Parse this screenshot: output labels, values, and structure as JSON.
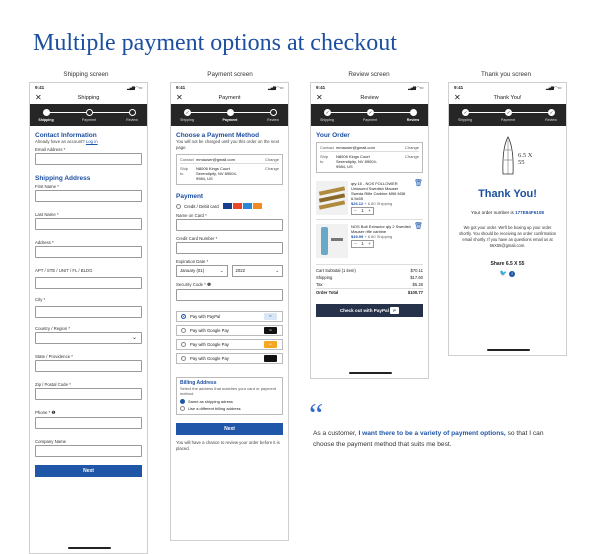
{
  "header": "Multiple payment options at checkout",
  "captions": [
    "Shipping screen",
    "Payment screen",
    "Review screen",
    "Thank you screen"
  ],
  "status_time": "9:41",
  "steps": [
    "Shipping",
    "Payment",
    "Review"
  ],
  "ship": {
    "title": "Shipping",
    "contact": "Contact Information",
    "account_q": "Already have an account?",
    "login": "Log in",
    "email": "Email Address *",
    "shipping_addr": "Shipping Address",
    "fields": [
      "First Name *",
      "Last Name *",
      "Address *",
      "APT / STE / UNIT / FL / BLDG",
      "City *",
      "Country / Region *",
      "State / Providence *",
      "Zip / Postal Code *",
      "Phone * ❶",
      "Company Name"
    ],
    "next": "Next"
  },
  "pay": {
    "title": "Payment",
    "choose": "Choose a Payment Method",
    "note": "You will not be charged until you this order on the next page.",
    "contact_k": "Contact",
    "contact_v": "mmauser@gmail.com",
    "change": "Change",
    "ship_k": "Ship to",
    "ship_v": "N8006 Kings Court Serendipity, NV 89004-9984, US",
    "payment": "Payment",
    "card": "Credit / Debit card",
    "name_card": "Name on Card *",
    "card_num": "Credit Card Number *",
    "exp": "Expiration Date *",
    "month": "January (01)",
    "year": "2022",
    "sec": "Security Code * ❶",
    "opts": [
      "Pay with PayPal",
      "Pay with Google Pay",
      "Pay with Google Pay",
      "Pay with Google Pay"
    ],
    "billing": "Billing Address",
    "billing_note": "Select the address that matches your card or payment method",
    "same": "Same as shipping adress",
    "diff": "Use a different billing address",
    "next": "Next",
    "footer": "You will have a chance to review your order before it is placed."
  },
  "rev": {
    "title": "Review",
    "your_order": "Your Order",
    "contact_k": "Contact",
    "contact_v": "mmauser@gmail.com",
    "ship_k": "Ship to",
    "ship_v": "N8006 Kings Court Serendipity, NV 89004-9984, US",
    "change": "Change",
    "item1": "qty:15 - NOS FOLLOWER Unissued Swedish Mauser Sweda Rifle Carbine M96 M38 6.5x55",
    "price1": "$26.12",
    "shipping1": "+ 6.80 Shipping",
    "item2": "NOS Bolt Extractor qty 2 Swedish Mauser rifle carbine",
    "price2": "$49.99",
    "shipping2": "+ 6.80 Shipping",
    "qty": "1",
    "subtotal_l": "Cart Subtotal (1 item)",
    "subtotal_v": "$70.11",
    "shipping_l": "Shipping",
    "shipping_v": "$17.60",
    "tax_l": "Tax",
    "tax_v": "$5.26",
    "total_l": "Order Total",
    "total_v": "$100.77",
    "checkout": "Check out with PayPal"
  },
  "ty": {
    "title": "Thank You!",
    "logo_text": "6.5 X 55",
    "heading": "Thank You!",
    "order_label": "Your order number is",
    "order_num": "177E84F6108",
    "msg": "We got your order. We'll be boxing up your order shortly. You should be receiving an order confirmation email shortly. If you have an questions email us at 66X55@gmail.com.",
    "share": "Share 6.5 X 55"
  },
  "quote": {
    "pre": "As a customer,",
    "highlight": "I want there to be a variety of payment options,",
    "post": "so that I can choose the payment method that suits me best."
  }
}
